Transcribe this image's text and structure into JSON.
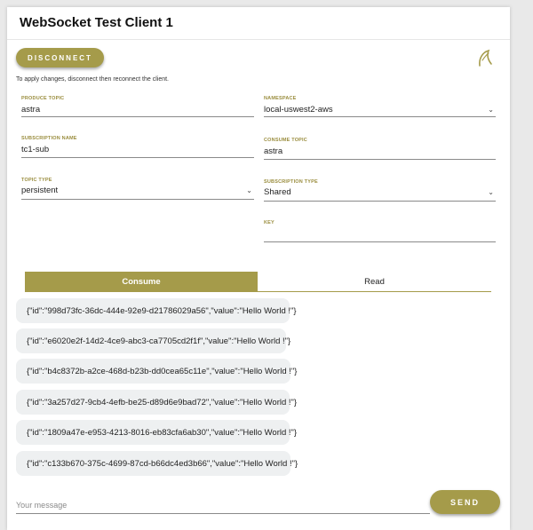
{
  "app": {
    "title": "WebSocket Test Client 1"
  },
  "connection": {
    "disconnect_label": "DISCONNECT",
    "hint": "To apply changes, disconnect then reconnect the client."
  },
  "form": {
    "produce_topic": {
      "label": "PRODUCE TOPIC",
      "value": "astra"
    },
    "namespace": {
      "label": "NAMESPACE",
      "value": "local-uswest2-aws"
    },
    "subscription_name": {
      "label": "SUBSCRIPTION NAME",
      "value": "tc1-sub"
    },
    "consume_topic": {
      "label": "CONSUME TOPIC",
      "value": "astra"
    },
    "topic_type": {
      "label": "TOPIC TYPE",
      "value": "persistent"
    },
    "subscription_type": {
      "label": "SUBSCRIPTION TYPE",
      "value": "Shared"
    },
    "key": {
      "label": "KEY",
      "value": ""
    }
  },
  "tabs": [
    {
      "label": "Consume",
      "active": true
    },
    {
      "label": "Read",
      "active": false
    }
  ],
  "messages": [
    "{\"id\":\"998d73fc-36dc-444e-92e9-d21786029a56\",\"value\":\"Hello World !\"}",
    "{\"id\":\"e6020e2f-14d2-4ce9-abc3-ca7705cd2f1f\",\"value\":\"Hello World !\"}",
    "{\"id\":\"b4c8372b-a2ce-468d-b23b-dd0cea65c11e\",\"value\":\"Hello World !\"}",
    "{\"id\":\"3a257d27-9cb4-4efb-be25-d89d6e9bad72\",\"value\":\"Hello World !\"}",
    "{\"id\":\"1809a47e-e953-4213-8016-eb83cfa6ab30\",\"value\":\"Hello World !\"}",
    "{\"id\":\"c133b670-375c-4699-87cd-b66dc4ed3b66\",\"value\":\"Hello World !\"}"
  ],
  "composer": {
    "placeholder": "Your message",
    "send_label": "SEND"
  },
  "colors": {
    "accent": "#a59b4a",
    "bubble": "#eef0f1",
    "label": "#9a8d3e"
  },
  "icons": {
    "logo": "feather-logo-icon",
    "dropdown": "chevron-down-icon"
  }
}
